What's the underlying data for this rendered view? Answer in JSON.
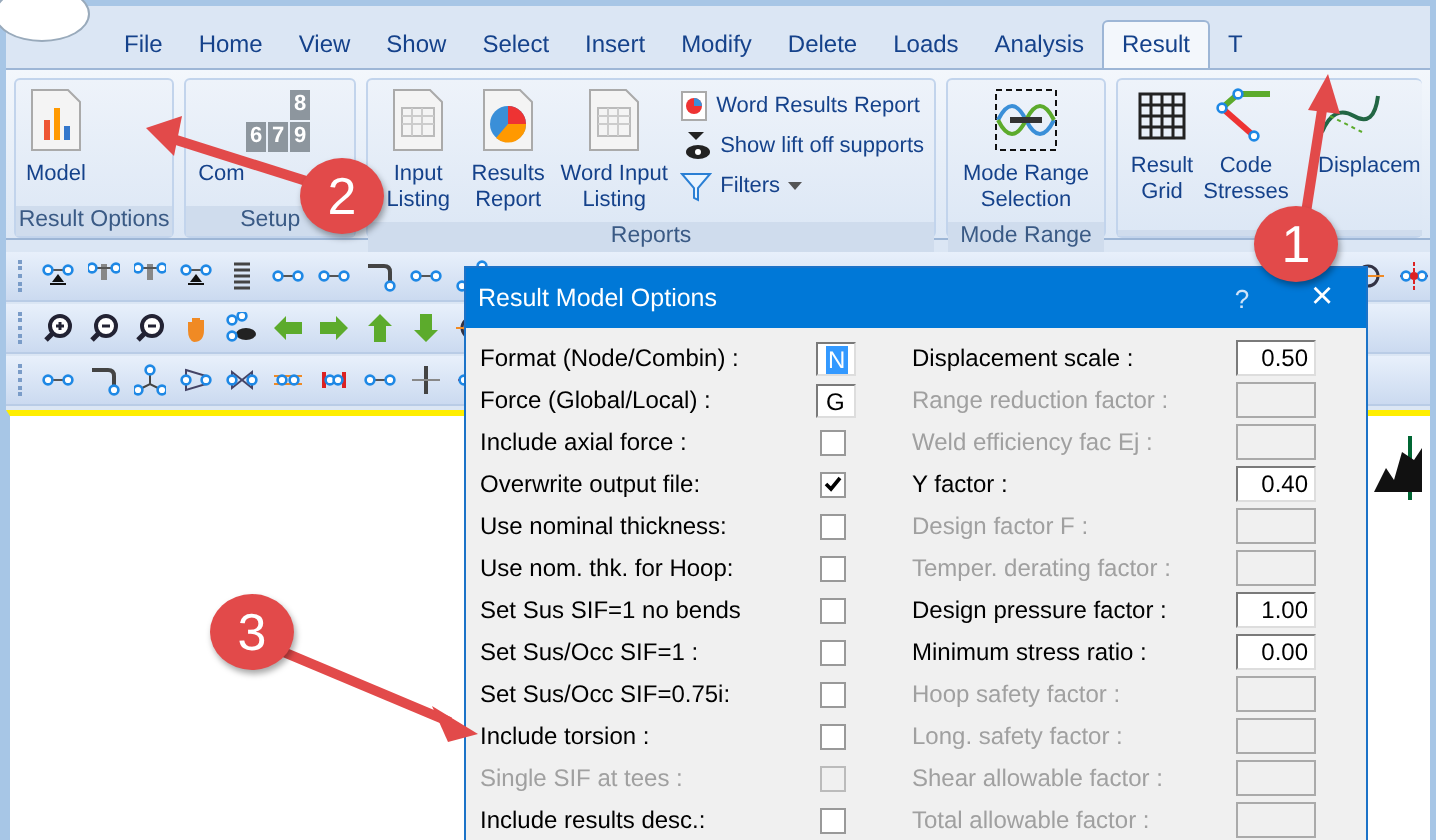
{
  "tabs": [
    {
      "label": "File",
      "selected": false
    },
    {
      "label": "Home",
      "selected": false
    },
    {
      "label": "View",
      "selected": false
    },
    {
      "label": "Show",
      "selected": false
    },
    {
      "label": "Select",
      "selected": false
    },
    {
      "label": "Insert",
      "selected": false
    },
    {
      "label": "Modify",
      "selected": false
    },
    {
      "label": "Delete",
      "selected": false
    },
    {
      "label": "Loads",
      "selected": false
    },
    {
      "label": "Analysis",
      "selected": false
    },
    {
      "label": "Result",
      "selected": true
    },
    {
      "label": "T",
      "selected": false
    }
  ],
  "ribbon": {
    "result_options": {
      "title": "Result Options",
      "button": "Model"
    },
    "setup": {
      "title": "Setup",
      "button": "Com",
      "tiles": [
        "8",
        "6",
        "7",
        "9"
      ]
    },
    "reports": {
      "title": "Reports",
      "buttons": [
        "Input Listing",
        "Results Report",
        "Word Input Listing"
      ],
      "small_buttons": [
        "Word Results Report",
        "Show lift off supports",
        "Filters"
      ]
    },
    "mode_range": {
      "title": "Mode Range",
      "button": "Mode Range Selection"
    },
    "results": {
      "buttons": [
        "Result Grid",
        "Code Stresses",
        "Displacem"
      ]
    }
  },
  "dialog": {
    "title": "Result Model Options",
    "help": "?",
    "close": "×",
    "left": [
      {
        "label": "Format (Node/Combin) :",
        "kind": "text",
        "value": "N",
        "selected": true,
        "disabled": false
      },
      {
        "label": "Force (Global/Local) :",
        "kind": "text",
        "value": "G",
        "selected": false,
        "disabled": false
      },
      {
        "label": "Include axial force :",
        "kind": "check",
        "checked": false,
        "disabled": false
      },
      {
        "label": "Overwrite output file:",
        "kind": "check",
        "checked": true,
        "disabled": false
      },
      {
        "label": "Use nominal thickness:",
        "kind": "check",
        "checked": false,
        "disabled": false
      },
      {
        "label": "Use nom. thk. for Hoop:",
        "kind": "check",
        "checked": false,
        "disabled": false
      },
      {
        "label": "Set Sus SIF=1 no bends",
        "kind": "check",
        "checked": false,
        "disabled": false
      },
      {
        "label": "Set Sus/Occ SIF=1 :",
        "kind": "check",
        "checked": false,
        "disabled": false
      },
      {
        "label": "Set Sus/Occ SIF=0.75i:",
        "kind": "check",
        "checked": false,
        "disabled": false
      },
      {
        "label": "Include torsion :",
        "kind": "check",
        "checked": false,
        "disabled": false
      },
      {
        "label": "Single SIF at tees :",
        "kind": "check",
        "checked": false,
        "disabled": true
      },
      {
        "label": "Include results desc.:",
        "kind": "check",
        "checked": false,
        "disabled": false
      }
    ],
    "right": [
      {
        "label": "Displacement scale :",
        "value": "0.50",
        "disabled": false
      },
      {
        "label": "Range reduction factor :",
        "disabled": true
      },
      {
        "label": "Weld efficiency fac Ej :",
        "disabled": true
      },
      {
        "label": "Y factor :",
        "value": "0.40",
        "disabled": false
      },
      {
        "label": "Design factor F :",
        "disabled": true
      },
      {
        "label": "Temper. derating factor :",
        "disabled": true
      },
      {
        "label": "Design pressure factor :",
        "value": "1.00",
        "disabled": false
      },
      {
        "label": "Minimum stress ratio :",
        "value": "0.00",
        "disabled": false
      },
      {
        "label": "Hoop safety factor :",
        "disabled": true
      },
      {
        "label": "Long. safety factor :",
        "disabled": true
      },
      {
        "label": "Shear allowable factor :",
        "disabled": true
      },
      {
        "label": "Total allowable factor :",
        "disabled": true
      }
    ]
  },
  "callouts": [
    {
      "label": "1"
    },
    {
      "label": "2"
    },
    {
      "label": "3"
    }
  ]
}
